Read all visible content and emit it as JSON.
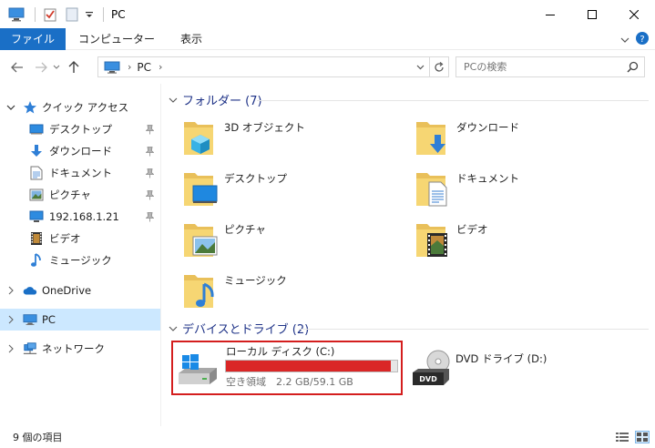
{
  "window": {
    "title": "PC"
  },
  "ribbon": {
    "tabs": [
      "ファイル",
      "コンピューター",
      "表示"
    ]
  },
  "address": {
    "crumb": "PC"
  },
  "search": {
    "placeholder": "PCの検索"
  },
  "sidebar": {
    "quick_access": "クイック アクセス",
    "items": [
      {
        "label": "デスクトップ",
        "icon": "desktop-icon",
        "pinned": true
      },
      {
        "label": "ダウンロード",
        "icon": "download-icon",
        "pinned": true
      },
      {
        "label": "ドキュメント",
        "icon": "document-icon",
        "pinned": true
      },
      {
        "label": "ピクチャ",
        "icon": "pictures-icon",
        "pinned": true
      },
      {
        "label": "192.168.1.21",
        "icon": "network-drive-icon",
        "pinned": true
      },
      {
        "label": "ビデオ",
        "icon": "video-icon",
        "pinned": false
      },
      {
        "label": "ミュージック",
        "icon": "music-icon",
        "pinned": false
      }
    ],
    "onedrive": "OneDrive",
    "pc": "PC",
    "network": "ネットワーク"
  },
  "folders_section": {
    "heading": "フォルダー (7)",
    "items": [
      {
        "label": "3D オブジェクト",
        "icon": "3d-objects-folder-icon"
      },
      {
        "label": "ダウンロード",
        "icon": "downloads-folder-icon"
      },
      {
        "label": "デスクトップ",
        "icon": "desktop-folder-icon"
      },
      {
        "label": "ドキュメント",
        "icon": "documents-folder-icon"
      },
      {
        "label": "ピクチャ",
        "icon": "pictures-folder-icon"
      },
      {
        "label": "ビデオ",
        "icon": "videos-folder-icon"
      },
      {
        "label": "ミュージック",
        "icon": "music-folder-icon"
      }
    ]
  },
  "drives_section": {
    "heading": "デバイスとドライブ (2)",
    "local": {
      "name": "ローカル ディスク (C:)",
      "free_text": "空き領域　2.2 GB/59.1 GB",
      "used_fraction": 0.963
    },
    "dvd": {
      "name": "DVD ドライブ (D:)"
    }
  },
  "status": {
    "text": "9 個の項目"
  },
  "colors": {
    "accent": "#1a6fc6",
    "selection": "#cce8ff",
    "drive_bar_full": "#da2626",
    "highlight_border": "#d41e1e",
    "section_heading": "#1e3287"
  }
}
